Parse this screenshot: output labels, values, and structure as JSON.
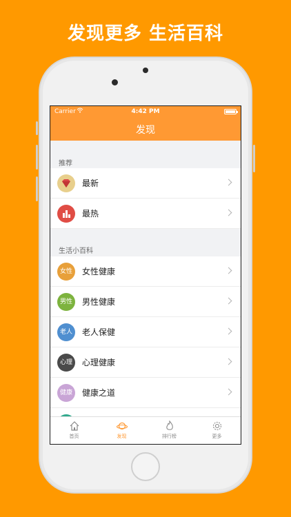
{
  "promo": {
    "title": "发现更多 生活百科"
  },
  "status_bar": {
    "carrier": "Carrier",
    "time": "4:42 PM"
  },
  "nav": {
    "title": "发现"
  },
  "sections": [
    {
      "header": "推荐",
      "items": [
        {
          "label": "最新",
          "icon": "gem-icon",
          "color": "#E8CF8C"
        },
        {
          "label": "最热",
          "icon": "fire-chart-icon",
          "color": "#E04D45"
        }
      ]
    },
    {
      "header": "生活小百科",
      "items": [
        {
          "label": "女性健康",
          "badge": "女性",
          "color": "#E8A03A"
        },
        {
          "label": "男性健康",
          "badge": "男性",
          "color": "#7DB33E"
        },
        {
          "label": "老人保健",
          "badge": "老人",
          "color": "#4F8FD0"
        },
        {
          "label": "心理健康",
          "badge": "心理",
          "color": "#4A4A4A"
        },
        {
          "label": "健康之道",
          "badge": "健康",
          "color": "#C9A5D6"
        },
        {
          "label": "",
          "badge": "",
          "color": "#2FA98C"
        }
      ]
    }
  ],
  "tabs": [
    {
      "label": "首页",
      "icon": "home-icon",
      "active": false
    },
    {
      "label": "发现",
      "icon": "planet-icon",
      "active": true
    },
    {
      "label": "排行榜",
      "icon": "flame-icon",
      "active": false
    },
    {
      "label": "更多",
      "icon": "gear-icon",
      "active": false
    }
  ],
  "colors": {
    "background": "#FF9900",
    "nav": "#FF9933",
    "accent": "#FF9933"
  }
}
